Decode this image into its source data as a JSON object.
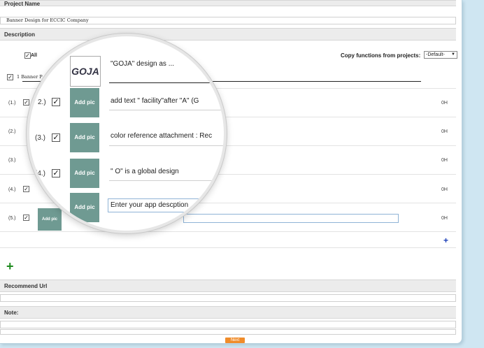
{
  "form": {
    "project_name_label": "Project Name",
    "project_name_value": "Banner Design for ECCIC Company",
    "description_label": "Description",
    "all_label": "All",
    "copy_label": "Copy functions from projects:",
    "copy_select_value": "-Default-",
    "first_row_text": "1  Banner P",
    "recommend_url_label": "Recommend Url",
    "note_label": "Note:",
    "next_label": "Next",
    "add_row_icon": "plus-blue-icon",
    "add_section_icon": "plus-green-icon"
  },
  "rows": [
    {
      "num": "(1.)",
      "hours": "0H"
    },
    {
      "num": "(2.)",
      "hours": "0H"
    },
    {
      "num": "(3.)",
      "hours": "0H"
    },
    {
      "num": "(4.)",
      "hours": "0H"
    },
    {
      "num": "(5.)",
      "hours": "0H"
    }
  ],
  "small_thumb_label": "Add pic",
  "lens": {
    "items": [
      {
        "num": "",
        "thumb": "GOJA",
        "desc": "\"GOJA\" design as ..."
      },
      {
        "num": "2.)",
        "thumb": "Add pic",
        "desc": "add text \" facility\"after \"A\" (G"
      },
      {
        "num": "(3.)",
        "thumb": "Add pic",
        "desc": "color reference attachment : Rec"
      },
      {
        "num": "(4.)",
        "thumb": "Add pic",
        "desc": "\" O\" is a global design"
      },
      {
        "num": "",
        "thumb": "Add pic",
        "desc": "Enter your app descption"
      }
    ]
  },
  "colors": {
    "thumb": "#6f9a92",
    "accent_orange": "#f08c2a",
    "background": "#cfe6f2"
  }
}
